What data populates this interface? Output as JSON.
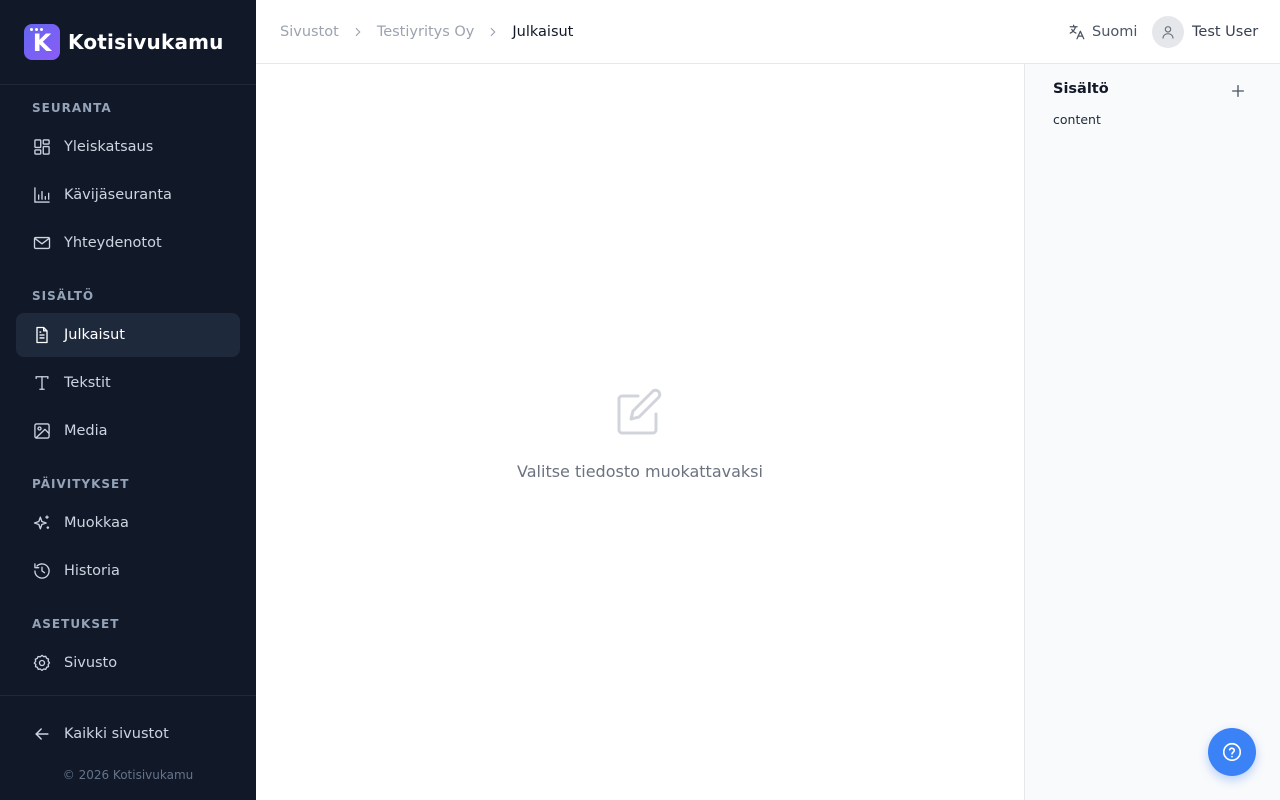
{
  "app": {
    "name": "Kotisivukamu",
    "logo_letter": "K"
  },
  "sidebar": {
    "sections": [
      {
        "title": "SEURANTA"
      },
      {
        "title": "SISÄLTÖ"
      },
      {
        "title": "PÄIVITYKSET"
      },
      {
        "title": "ASETUKSET"
      }
    ],
    "items": [
      {
        "label": "Yleiskatsaus",
        "icon": "dashboard-icon"
      },
      {
        "label": "Kävijäseuranta",
        "icon": "bar-chart-icon"
      },
      {
        "label": "Yhteydenotot",
        "icon": "mail-icon"
      },
      {
        "label": "Julkaisut",
        "icon": "document-icon",
        "active": true
      },
      {
        "label": "Tekstit",
        "icon": "text-icon"
      },
      {
        "label": "Media",
        "icon": "image-icon"
      },
      {
        "label": "Muokkaa",
        "icon": "sparkles-icon"
      },
      {
        "label": "Historia",
        "icon": "history-icon"
      },
      {
        "label": "Sivusto",
        "icon": "gear-icon"
      }
    ],
    "back_label": "Kaikki sivustot",
    "copyright": "© 2026 Kotisivukamu"
  },
  "header": {
    "breadcrumb": [
      "Sivustot",
      "Testiyritys Oy",
      "Julkaisut"
    ],
    "language": "Suomi",
    "user_name": "Test User"
  },
  "main": {
    "empty_text": "Valitse tiedosto muokattavaksi"
  },
  "panel": {
    "title": "Sisältö",
    "items": [
      "content"
    ]
  },
  "colors": {
    "sidebar_bg": "#111827",
    "accent": "#3b82f6",
    "brand": "#6366f1"
  }
}
